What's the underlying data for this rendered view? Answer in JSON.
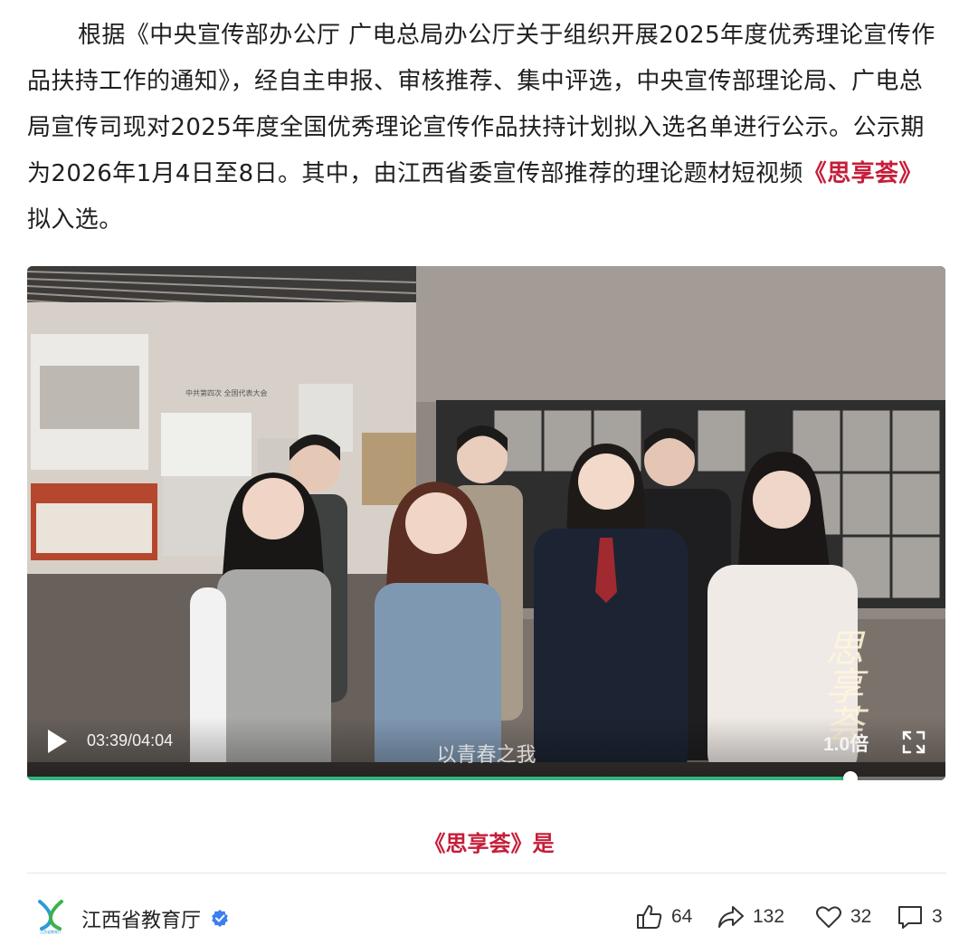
{
  "article": {
    "paragraph_before": "根据《中央宣传部办公厅 广电总局办公厅关于组织开展2025年度优秀理论宣传作品扶持工作的通知》，经自主申报、审核推荐、集中评选，中央宣传部理论局、广电总局宣传司现对2025年度全国优秀理论宣传作品扶持计划拟入选名单进行公示。公示期为2026年1月4日至8日。其中，由江西省委宣传部推荐的理论题材短视频",
    "highlight": "《思享荟》",
    "paragraph_after": "拟入选。"
  },
  "video": {
    "current_time": "03:39",
    "separator": "/",
    "total_time": "04:04",
    "subtitle": "以青春之我",
    "speed_label": "1.0倍",
    "watermark": "思享荟",
    "progress_fraction": 0.897,
    "exhibit_wall_text": [
      "中共第四次 全国代表大会"
    ],
    "icons": [
      "play-icon",
      "fullscreen-icon"
    ]
  },
  "caption": "《思享荟》是",
  "footer": {
    "account_name": "江西省教育厅",
    "logo_caption": "江西省教育厅",
    "stats": {
      "likes": "64",
      "shares": "132",
      "favorites": "32",
      "comments": "3"
    },
    "icons": [
      "thumbs-up-icon",
      "share-arrow-icon",
      "heart-icon",
      "comment-icon",
      "verified-badge-icon"
    ]
  },
  "colors": {
    "highlight_red": "#c41e3a",
    "progress_green": "#2fb67c",
    "verified_blue": "#3d7ef0"
  }
}
